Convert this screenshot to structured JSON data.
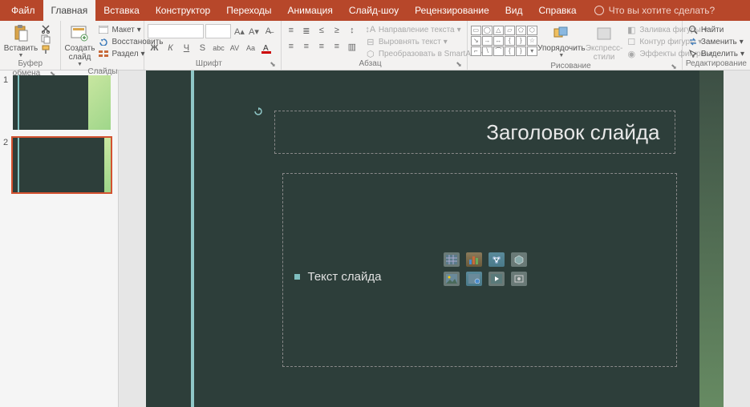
{
  "tabs": [
    "Файл",
    "Главная",
    "Вставка",
    "Конструктор",
    "Переходы",
    "Анимация",
    "Слайд-шоу",
    "Рецензирование",
    "Вид",
    "Справка"
  ],
  "active_tab_index": 1,
  "tell_me": "Что вы хотите сделать?",
  "ribbon": {
    "clipboard": {
      "paste": "Вставить",
      "label": "Буфер обмена"
    },
    "slides": {
      "new": "Создать\nслайд",
      "layout": "Макет",
      "reset": "Восстановить",
      "section": "Раздел",
      "label": "Слайды"
    },
    "font": {
      "label": "Шрифт",
      "bold": "Ж",
      "italic": "К",
      "underline": "Ч",
      "strike": "S",
      "shadow": "abc",
      "spacing": "AV",
      "case": "Aa"
    },
    "paragraph": {
      "label": "Абзац",
      "textdir": "Направление текста",
      "align": "Выровнять текст",
      "smartart": "Преобразовать в SmartArt"
    },
    "drawing": {
      "label": "Рисование",
      "arrange": "Упорядочить",
      "express": "Экспресс-\nстили",
      "fill": "Заливка фигуры",
      "outline": "Контур фигуры",
      "effects": "Эффекты фигуры"
    },
    "editing": {
      "label": "Редактирование",
      "find": "Найти",
      "replace": "Заменить",
      "select": "Выделить"
    }
  },
  "thumbs": [
    {
      "num": "1",
      "selected": false
    },
    {
      "num": "2",
      "selected": true
    }
  ],
  "slide": {
    "title_placeholder": "Заголовок слайда",
    "content_placeholder": "Текст слайда"
  }
}
